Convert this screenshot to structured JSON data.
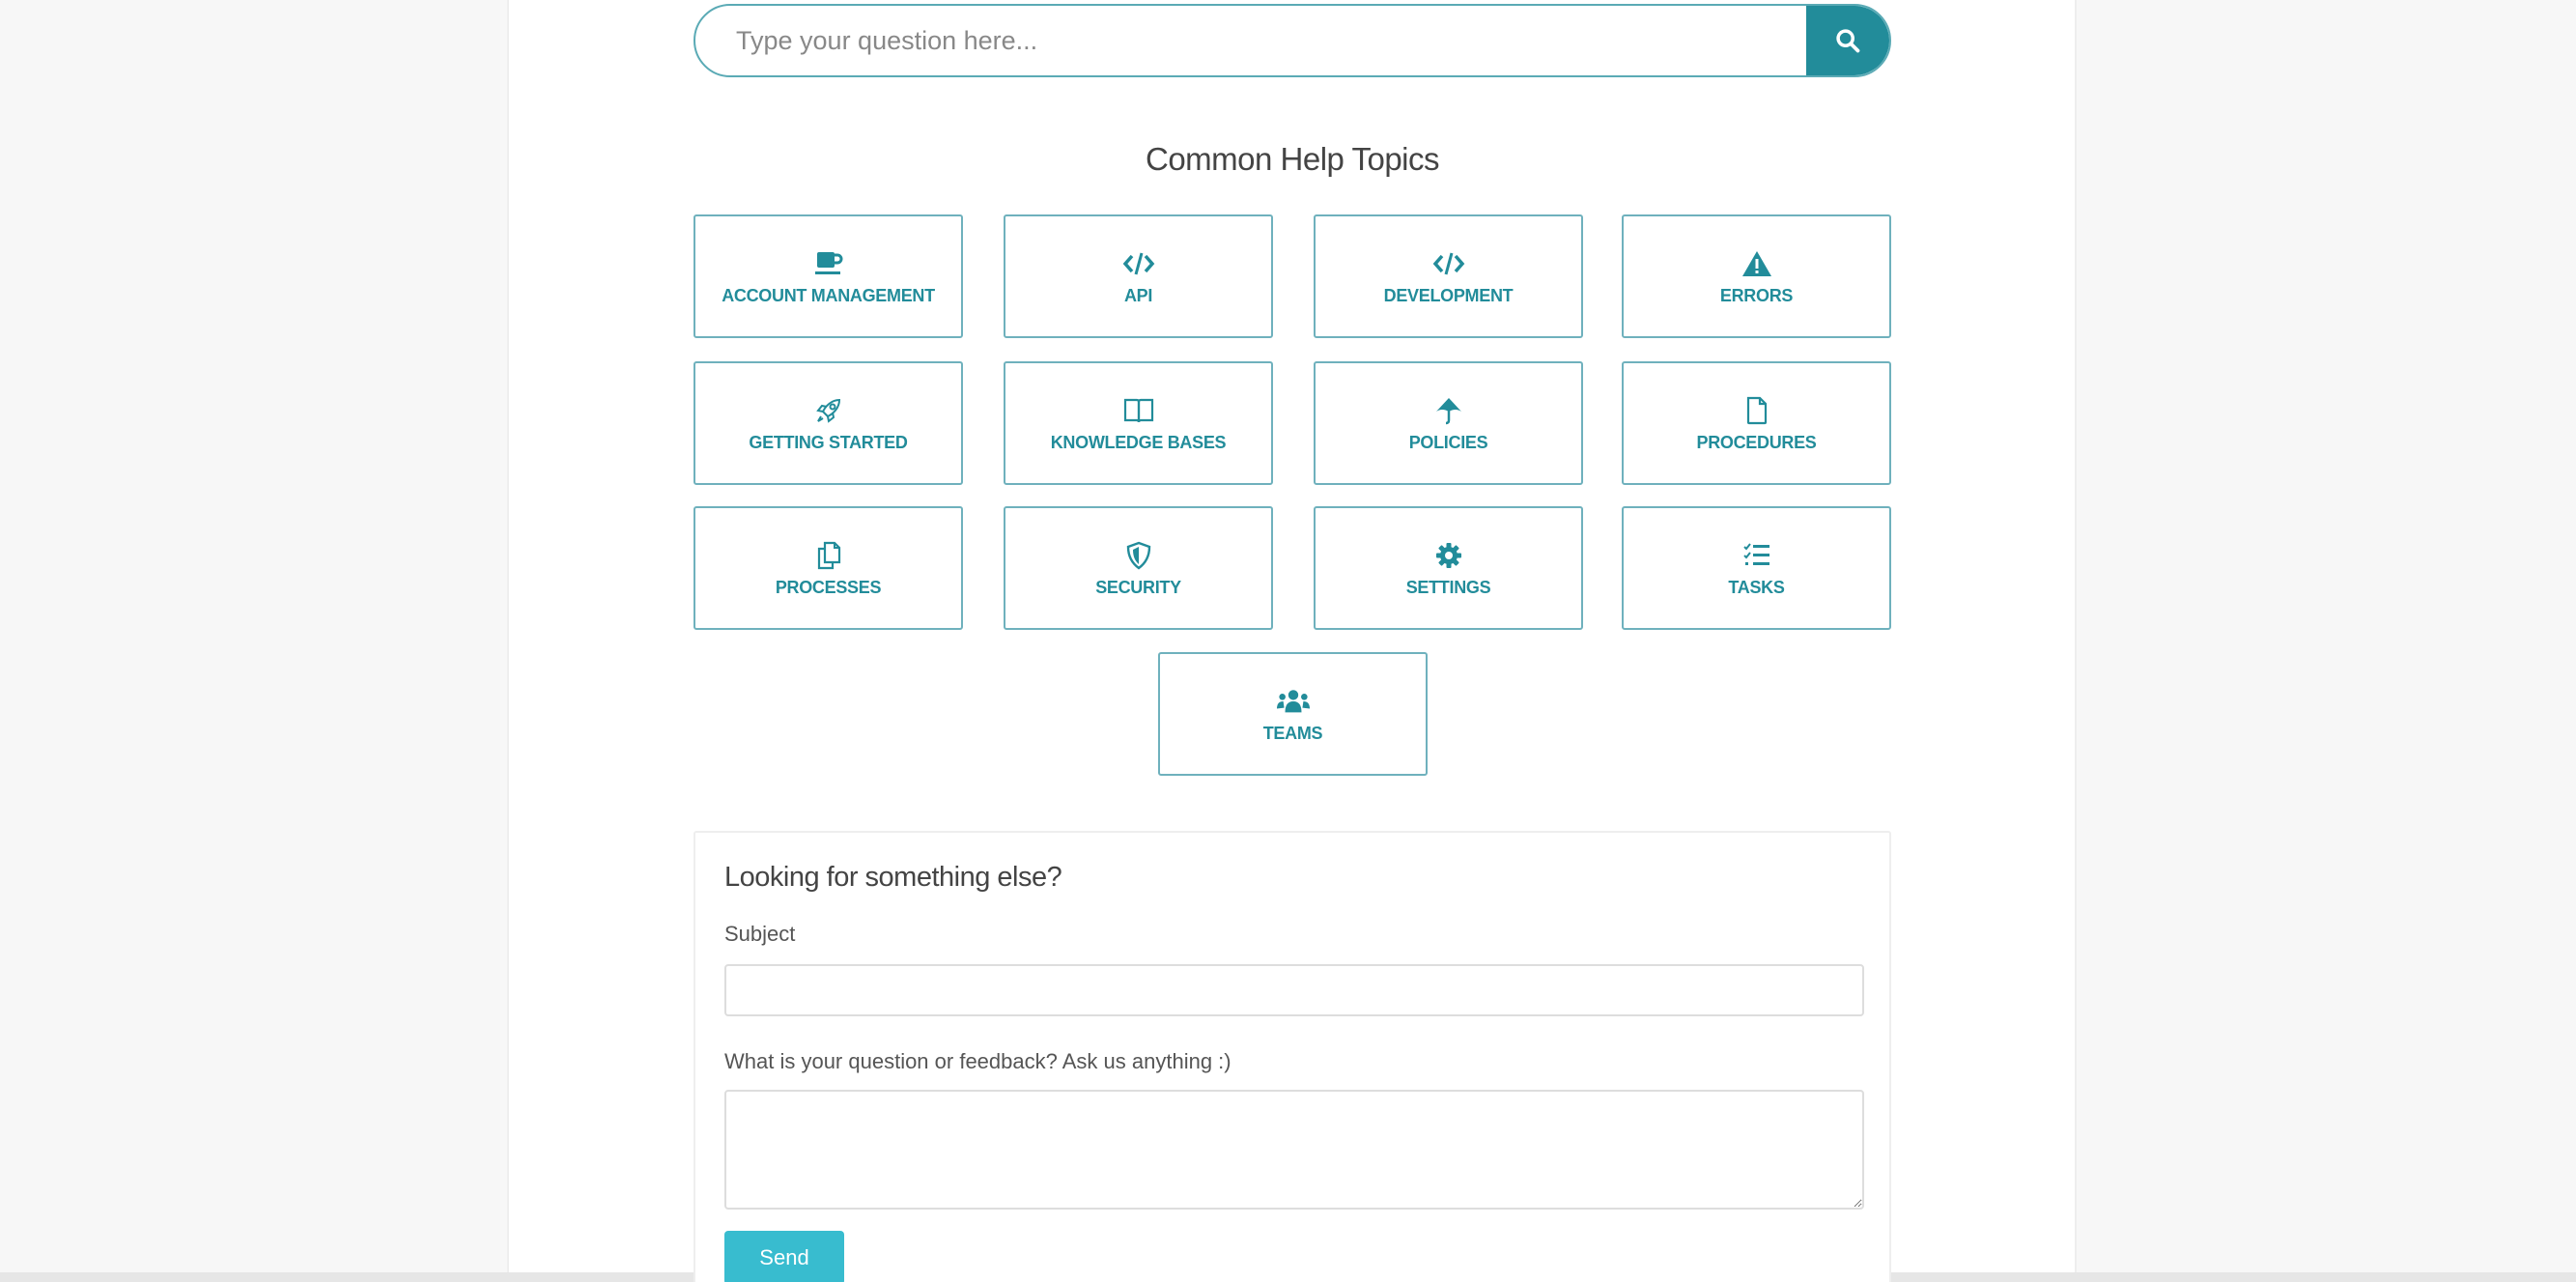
{
  "search": {
    "placeholder": "Type your question here...",
    "value": "",
    "button_icon": "search-icon"
  },
  "topics": {
    "title": "Common Help Topics",
    "items": [
      {
        "label": "ACCOUNT MANAGEMENT",
        "icon": "coffee-cup-icon"
      },
      {
        "label": "API",
        "icon": "code-icon"
      },
      {
        "label": "DEVELOPMENT",
        "icon": "code-icon"
      },
      {
        "label": "ERRORS",
        "icon": "warning-triangle-icon"
      },
      {
        "label": "GETTING STARTED",
        "icon": "rocket-icon"
      },
      {
        "label": "KNOWLEDGE BASES",
        "icon": "open-book-icon"
      },
      {
        "label": "POLICIES",
        "icon": "umbrella-icon"
      },
      {
        "label": "PROCEDURES",
        "icon": "file-icon"
      },
      {
        "label": "PROCESSES",
        "icon": "copy-files-icon"
      },
      {
        "label": "SECURITY",
        "icon": "shield-icon"
      },
      {
        "label": "SETTINGS",
        "icon": "gear-icon"
      },
      {
        "label": "TASKS",
        "icon": "checklist-icon"
      },
      {
        "label": "TEAMS",
        "icon": "users-group-icon"
      }
    ]
  },
  "contact_form": {
    "title": "Looking for something else?",
    "subject_label": "Subject",
    "subject_value": "",
    "message_label": "What is your question or feedback? Ask us anything :)",
    "message_value": "",
    "send_label": "Send"
  },
  "colors": {
    "accent": "#228c9a",
    "card_border": "#6fb1bd",
    "send_button": "#38bccf",
    "page_background": "#f7f7f7"
  }
}
